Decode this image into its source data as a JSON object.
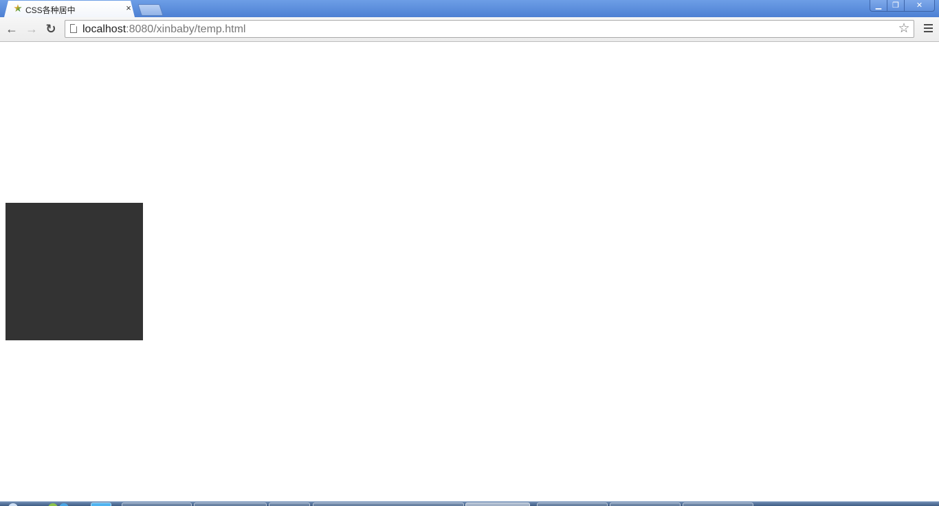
{
  "browser": {
    "tab": {
      "title": "CSS各种居中",
      "favicon": "star-icon",
      "close_glyph": "×"
    },
    "window_controls": {
      "minimize_glyph": "▁",
      "restore_glyph": "❐",
      "close_glyph": "✕"
    },
    "toolbar": {
      "back_glyph": "←",
      "forward_glyph": "→",
      "reload_glyph": "↻",
      "bookmark_glyph": "☆"
    },
    "omnibox": {
      "url_host": "localhost",
      "url_path": ":8080/xinbaby/temp.html"
    }
  },
  "page": {
    "box_color": "#333333"
  },
  "colors": {
    "titlebar": "#4d80d3",
    "toolbar": "#ececec",
    "page_background": "#ffffff"
  }
}
